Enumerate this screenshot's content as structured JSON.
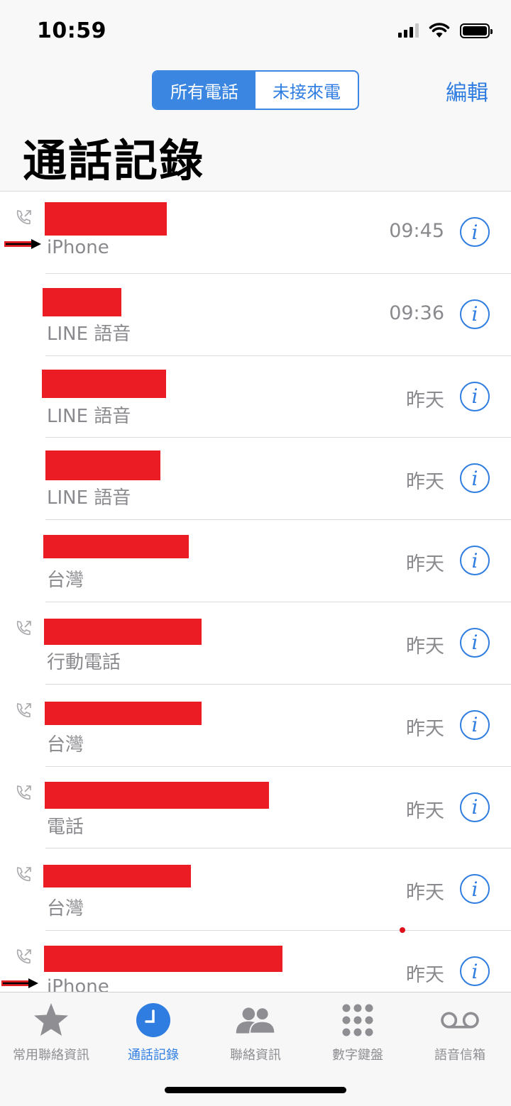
{
  "status_bar": {
    "time": "10:59"
  },
  "nav": {
    "segments": [
      "所有電話",
      "未接來電"
    ],
    "active_segment": 0,
    "edit_label": "編輯",
    "title": "通話記錄"
  },
  "calls": [
    {
      "type": "iPhone",
      "time": "09:45",
      "outgoing": true,
      "marked": true
    },
    {
      "type": "LINE 語音",
      "time": "09:36",
      "outgoing": false,
      "marked": false
    },
    {
      "type": "LINE 語音",
      "time": "昨天",
      "outgoing": false,
      "marked": false
    },
    {
      "type": "LINE 語音",
      "time": "昨天",
      "outgoing": false,
      "marked": false
    },
    {
      "type": "台灣",
      "time": "昨天",
      "outgoing": false,
      "marked": false
    },
    {
      "type": "行動電話",
      "time": "昨天",
      "outgoing": true,
      "marked": false
    },
    {
      "type": "台灣",
      "time": "昨天",
      "outgoing": true,
      "marked": false
    },
    {
      "type": "電話",
      "time": "昨天",
      "outgoing": true,
      "marked": false
    },
    {
      "type": "台灣",
      "time": "昨天",
      "outgoing": true,
      "marked": false
    },
    {
      "type": "iPhone",
      "time": "昨天",
      "outgoing": true,
      "marked": true
    }
  ],
  "tabs": [
    {
      "label": "常用聯絡資訊",
      "icon": "star-icon"
    },
    {
      "label": "通話記錄",
      "icon": "clock-icon"
    },
    {
      "label": "聯絡資訊",
      "icon": "contacts-icon"
    },
    {
      "label": "數字鍵盤",
      "icon": "keypad-icon"
    },
    {
      "label": "語音信箱",
      "icon": "voicemail-icon"
    }
  ],
  "active_tab": 1,
  "colors": {
    "accent": "#2f7de1",
    "redaction": "#ec1c24",
    "secondary_text": "#8a8a8e"
  }
}
